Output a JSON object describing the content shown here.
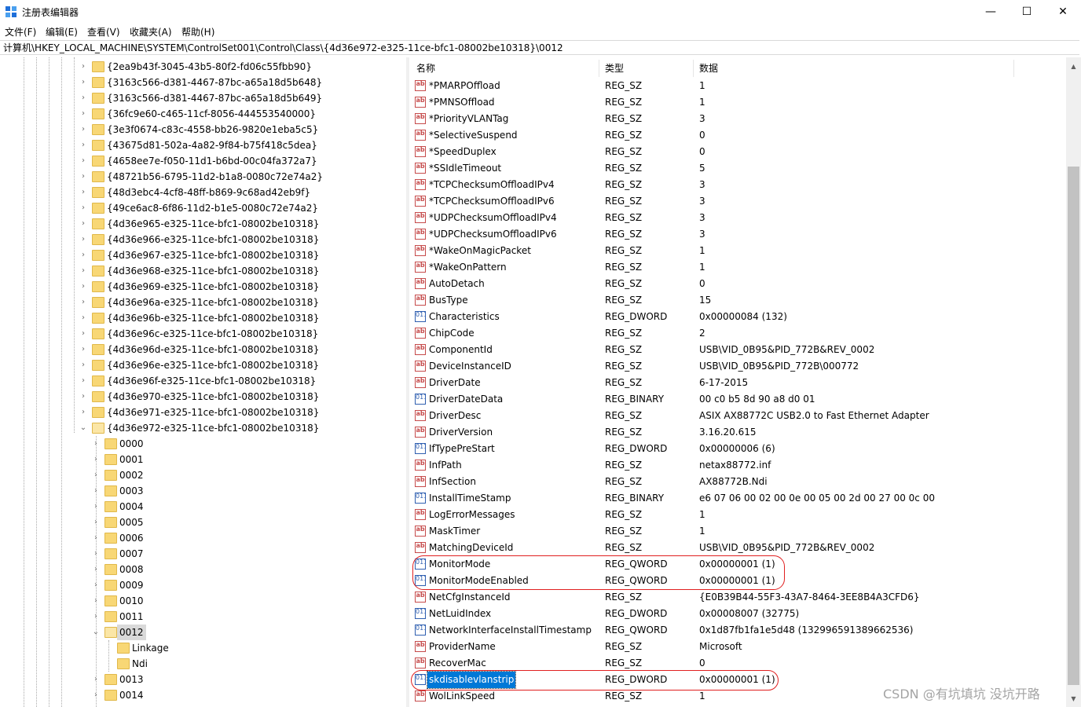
{
  "window": {
    "title": "注册表编辑器",
    "minimize_glyph": "—",
    "maximize_glyph": "☐",
    "close_glyph": "✕"
  },
  "menu": [
    "文件(F)",
    "编辑(E)",
    "查看(V)",
    "收藏夹(A)",
    "帮助(H)"
  ],
  "address": "计算机\\HKEY_LOCAL_MACHINE\\SYSTEM\\ControlSet001\\Control\\Class\\{4d36e972-e325-11ce-bfc1-08002be10318}\\0012",
  "tree": {
    "class_keys": [
      "{2ea9b43f-3045-43b5-80f2-fd06c55fbb90}",
      "{3163c566-d381-4467-87bc-a65a18d5b648}",
      "{3163c566-d381-4467-87bc-a65a18d5b649}",
      "{36fc9e60-c465-11cf-8056-444553540000}",
      "{3e3f0674-c83c-4558-bb26-9820e1eba5c5}",
      "{43675d81-502a-4a82-9f84-b75f418c5dea}",
      "{4658ee7e-f050-11d1-b6bd-00c04fa372a7}",
      "{48721b56-6795-11d2-b1a8-0080c72e74a2}",
      "{48d3ebc4-4cf8-48ff-b869-9c68ad42eb9f}",
      "{49ce6ac8-6f86-11d2-b1e5-0080c72e74a2}",
      "{4d36e965-e325-11ce-bfc1-08002be10318}",
      "{4d36e966-e325-11ce-bfc1-08002be10318}",
      "{4d36e967-e325-11ce-bfc1-08002be10318}",
      "{4d36e968-e325-11ce-bfc1-08002be10318}",
      "{4d36e969-e325-11ce-bfc1-08002be10318}",
      "{4d36e96a-e325-11ce-bfc1-08002be10318}",
      "{4d36e96b-e325-11ce-bfc1-08002be10318}",
      "{4d36e96c-e325-11ce-bfc1-08002be10318}",
      "{4d36e96d-e325-11ce-bfc1-08002be10318}",
      "{4d36e96e-e325-11ce-bfc1-08002be10318}",
      "{4d36e96f-e325-11ce-bfc1-08002be10318}",
      "{4d36e970-e325-11ce-bfc1-08002be10318}",
      "{4d36e971-e325-11ce-bfc1-08002be10318}"
    ],
    "expanded_key": "{4d36e972-e325-11ce-bfc1-08002be10318}",
    "sub_keys_before": [
      "0000",
      "0001",
      "0002",
      "0003",
      "0004",
      "0005",
      "0006",
      "0007",
      "0008",
      "0009",
      "0010",
      "0011"
    ],
    "selected_key": "0012",
    "selected_children": [
      "Linkage",
      "Ndi"
    ],
    "sub_keys_after": [
      "0013",
      "0014"
    ]
  },
  "columns": {
    "name": "名称",
    "type": "类型",
    "data": "数据"
  },
  "values": [
    {
      "name": "*PMARPOffload",
      "type": "REG_SZ",
      "data": "1",
      "icon": "sz"
    },
    {
      "name": "*PMNSOffload",
      "type": "REG_SZ",
      "data": "1",
      "icon": "sz"
    },
    {
      "name": "*PriorityVLANTag",
      "type": "REG_SZ",
      "data": "3",
      "icon": "sz"
    },
    {
      "name": "*SelectiveSuspend",
      "type": "REG_SZ",
      "data": "0",
      "icon": "sz"
    },
    {
      "name": "*SpeedDuplex",
      "type": "REG_SZ",
      "data": "0",
      "icon": "sz"
    },
    {
      "name": "*SSIdleTimeout",
      "type": "REG_SZ",
      "data": "5",
      "icon": "sz"
    },
    {
      "name": "*TCPChecksumOffloadIPv4",
      "type": "REG_SZ",
      "data": "3",
      "icon": "sz"
    },
    {
      "name": "*TCPChecksumOffloadIPv6",
      "type": "REG_SZ",
      "data": "3",
      "icon": "sz"
    },
    {
      "name": "*UDPChecksumOffloadIPv4",
      "type": "REG_SZ",
      "data": "3",
      "icon": "sz"
    },
    {
      "name": "*UDPChecksumOffloadIPv6",
      "type": "REG_SZ",
      "data": "3",
      "icon": "sz"
    },
    {
      "name": "*WakeOnMagicPacket",
      "type": "REG_SZ",
      "data": "1",
      "icon": "sz"
    },
    {
      "name": "*WakeOnPattern",
      "type": "REG_SZ",
      "data": "1",
      "icon": "sz"
    },
    {
      "name": "AutoDetach",
      "type": "REG_SZ",
      "data": "0",
      "icon": "sz"
    },
    {
      "name": "BusType",
      "type": "REG_SZ",
      "data": "15",
      "icon": "sz"
    },
    {
      "name": "Characteristics",
      "type": "REG_DWORD",
      "data": "0x00000084 (132)",
      "icon": "bin"
    },
    {
      "name": "ChipCode",
      "type": "REG_SZ",
      "data": "2",
      "icon": "sz"
    },
    {
      "name": "ComponentId",
      "type": "REG_SZ",
      "data": "USB\\VID_0B95&PID_772B&REV_0002",
      "icon": "sz"
    },
    {
      "name": "DeviceInstanceID",
      "type": "REG_SZ",
      "data": "USB\\VID_0B95&PID_772B\\000772",
      "icon": "sz"
    },
    {
      "name": "DriverDate",
      "type": "REG_SZ",
      "data": "6-17-2015",
      "icon": "sz"
    },
    {
      "name": "DriverDateData",
      "type": "REG_BINARY",
      "data": "00 c0 b5 8d 90 a8 d0 01",
      "icon": "bin"
    },
    {
      "name": "DriverDesc",
      "type": "REG_SZ",
      "data": "ASIX AX88772C USB2.0 to Fast Ethernet Adapter",
      "icon": "sz"
    },
    {
      "name": "DriverVersion",
      "type": "REG_SZ",
      "data": "3.16.20.615",
      "icon": "sz"
    },
    {
      "name": "IfTypePreStart",
      "type": "REG_DWORD",
      "data": "0x00000006 (6)",
      "icon": "bin"
    },
    {
      "name": "InfPath",
      "type": "REG_SZ",
      "data": "netax88772.inf",
      "icon": "sz"
    },
    {
      "name": "InfSection",
      "type": "REG_SZ",
      "data": "AX88772B.Ndi",
      "icon": "sz"
    },
    {
      "name": "InstallTimeStamp",
      "type": "REG_BINARY",
      "data": "e6 07 06 00 02 00 0e 00 05 00 2d 00 27 00 0c 00",
      "icon": "bin"
    },
    {
      "name": "LogErrorMessages",
      "type": "REG_SZ",
      "data": "1",
      "icon": "sz"
    },
    {
      "name": "MaskTimer",
      "type": "REG_SZ",
      "data": "1",
      "icon": "sz"
    },
    {
      "name": "MatchingDeviceId",
      "type": "REG_SZ",
      "data": "USB\\VID_0B95&PID_772B&REV_0002",
      "icon": "sz"
    },
    {
      "name": "MonitorMode",
      "type": "REG_QWORD",
      "data": "0x00000001 (1)",
      "icon": "bin"
    },
    {
      "name": "MonitorModeEnabled",
      "type": "REG_QWORD",
      "data": "0x00000001 (1)",
      "icon": "bin"
    },
    {
      "name": "NetCfgInstanceId",
      "type": "REG_SZ",
      "data": "{E0B39B44-55F3-43A7-8464-3EE8B4A3CFD6}",
      "icon": "sz"
    },
    {
      "name": "NetLuidIndex",
      "type": "REG_DWORD",
      "data": "0x00008007 (32775)",
      "icon": "bin"
    },
    {
      "name": "NetworkInterfaceInstallTimestamp",
      "type": "REG_QWORD",
      "data": "0x1d87fb1fa1e5d48 (132996591389662536)",
      "icon": "bin"
    },
    {
      "name": "ProviderName",
      "type": "REG_SZ",
      "data": "Microsoft",
      "icon": "sz"
    },
    {
      "name": "RecoverMac",
      "type": "REG_SZ",
      "data": "0",
      "icon": "sz"
    },
    {
      "name": "skdisablevlanstrip",
      "type": "REG_DWORD",
      "data": "0x00000001 (1)",
      "icon": "bin",
      "selected": true
    },
    {
      "name": "WolLinkSpeed",
      "type": "REG_SZ",
      "data": "1",
      "icon": "sz"
    }
  ],
  "icon_text": {
    "sz": "ab",
    "bin": "011 110"
  },
  "watermark": "CSDN @有坑填坑 没坑开路",
  "colors": {
    "selection": "#0078d7",
    "annotation": "#e02020",
    "folder": "#f8d775"
  }
}
